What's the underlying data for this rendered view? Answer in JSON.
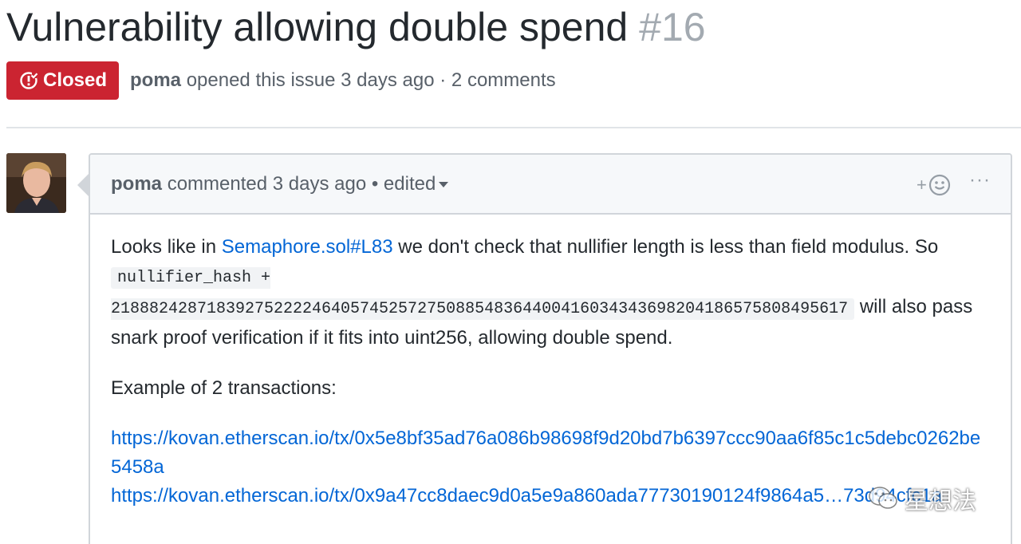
{
  "issue": {
    "title": "Vulnerability allowing double spend",
    "number": "#16",
    "state": "Closed",
    "state_icon": "issue-closed-icon",
    "author": "poma",
    "opened_text": "opened this issue 3 days ago",
    "separator": "·",
    "comments_count": "2 comments"
  },
  "comment": {
    "author": "poma",
    "commented_text": "commented 3 days ago",
    "bullet": "•",
    "edited_label": "edited",
    "reaction_plus": "+",
    "reaction_icon": "smiley-icon",
    "more_icon": "kebab-icon",
    "more_label": "···",
    "body": {
      "p1_pre": "Looks like in ",
      "p1_link": "Semaphore.sol#L83",
      "p1_mid": " we don't check that nullifier length is less than field modulus. So ",
      "p1_code": "nullifier_hash + 21888242871839275222246405745257275088548364400416034343698204186575808495617",
      "p1_post": " will also pass snark proof verification if it fits into uint256, allowing double spend.",
      "p2": "Example of 2 transactions:",
      "links": [
        "https://kovan.etherscan.io/tx/0x5e8bf35ad76a086b98698f9d20bd7b6397ccc90aa6f85c1c5debc0262be5458a",
        "https://kovan.etherscan.io/tx/0x9a47cc8daec9d0a5e9a860ada77730190124f9864a5…73d94cfc1a"
      ]
    }
  },
  "colors": {
    "closed_red": "#cb2431",
    "link_blue": "#0366d6",
    "muted_gray": "#586069"
  }
}
